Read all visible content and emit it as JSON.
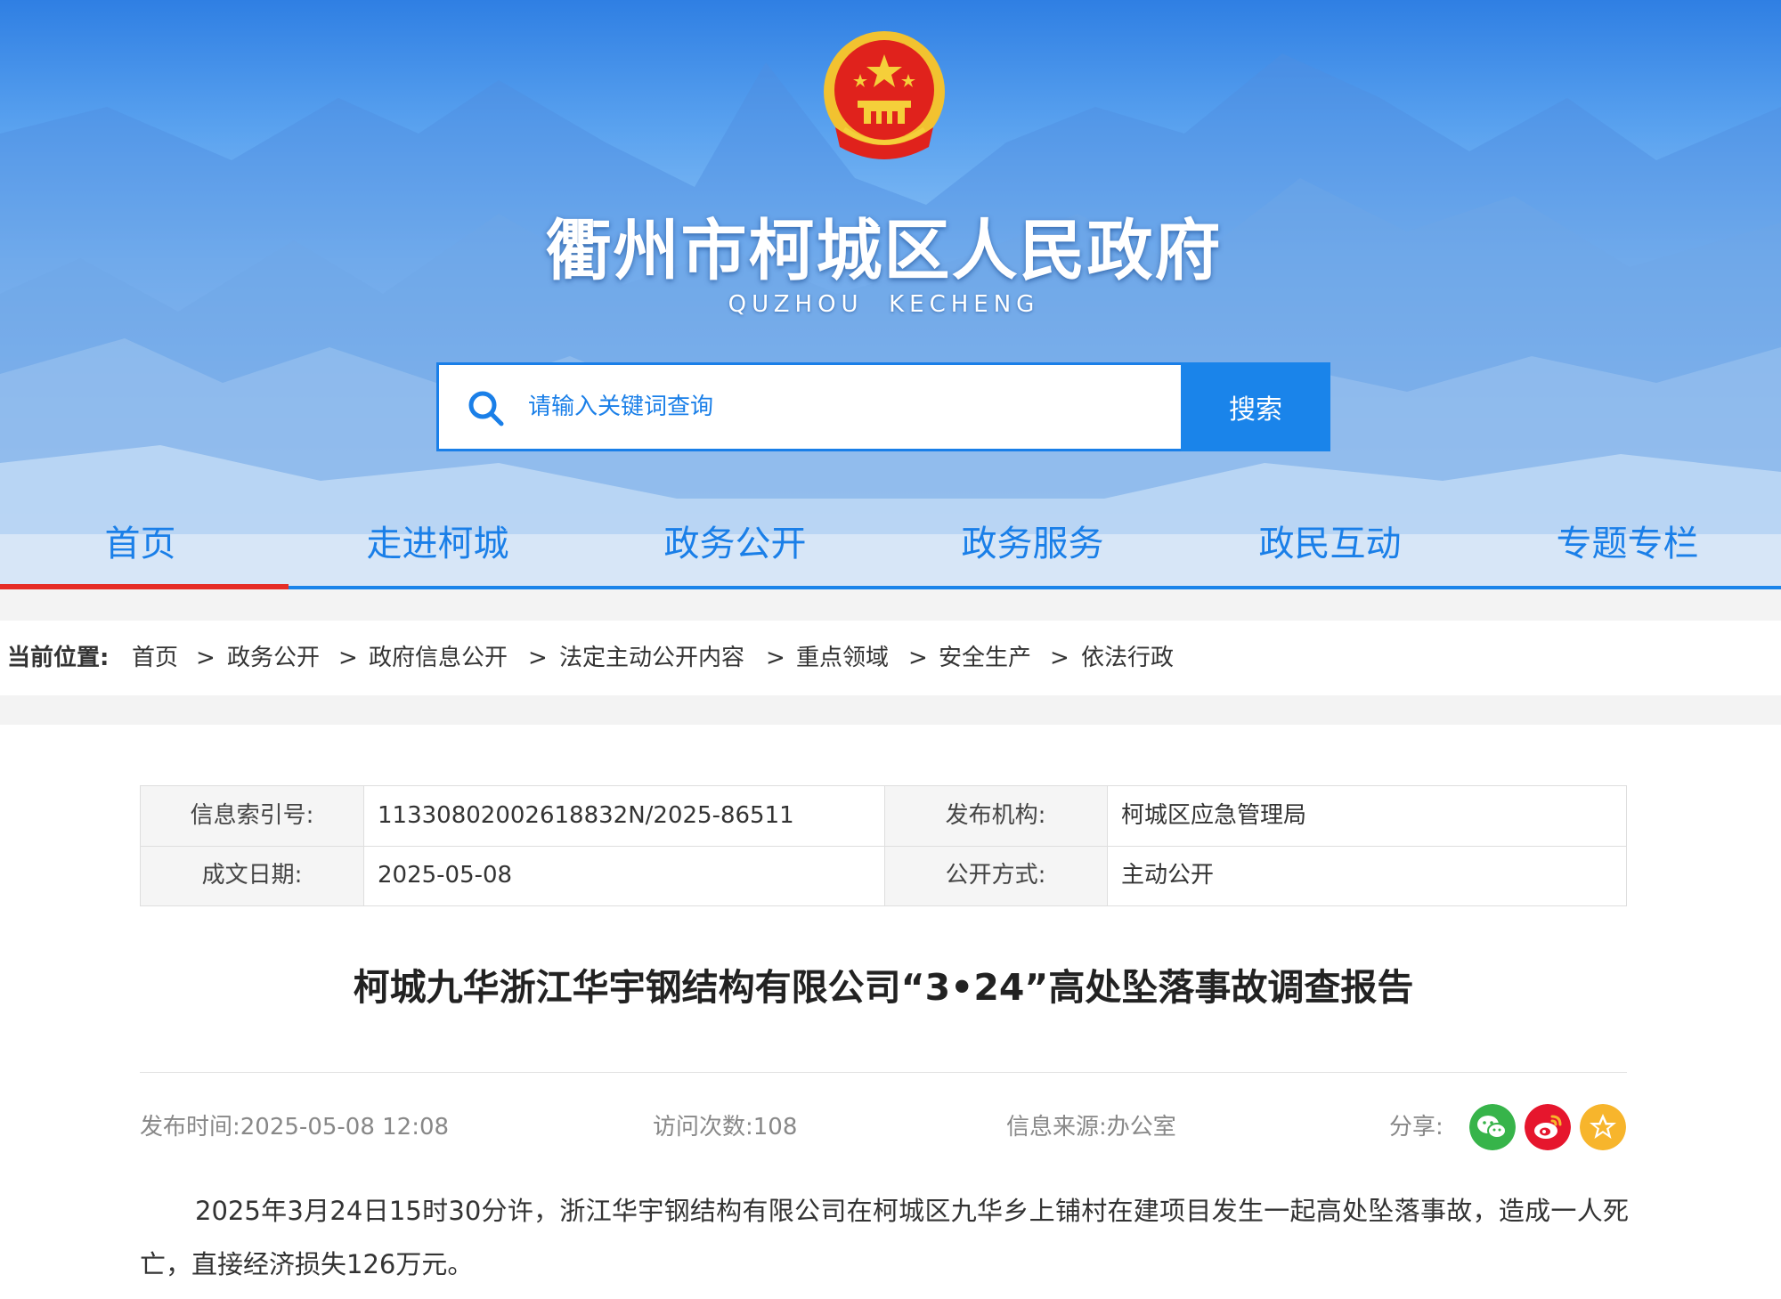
{
  "header": {
    "site_title": "衢州市柯城区人民政府",
    "site_subtitle": "QUZHOU  KECHENG",
    "search": {
      "placeholder": "请输入关键词查询",
      "button_label": "搜索"
    }
  },
  "nav": {
    "items": [
      {
        "label": "首页",
        "active": true
      },
      {
        "label": "走进柯城"
      },
      {
        "label": "政务公开"
      },
      {
        "label": "政务服务"
      },
      {
        "label": "政民互动"
      },
      {
        "label": "专题专栏"
      }
    ]
  },
  "breadcrumb": {
    "label": "当前位置:",
    "separator": ">",
    "items": [
      "首页",
      "政务公开",
      "政府信息公开",
      "法定主动公开内容",
      "重点领域",
      "安全生产",
      "依法行政"
    ]
  },
  "info_table": {
    "index_label": "信息索引号:",
    "index_value": "11330802002618832N/2025-86511",
    "publisher_label": "发布机构:",
    "publisher_value": "柯城区应急管理局",
    "date_label": "成文日期:",
    "date_value": "2025-05-08",
    "mode_label": "公开方式:",
    "mode_value": "主动公开"
  },
  "article": {
    "title": "柯城九华浙江华宇钢结构有限公司“3•24”高处坠落事故调查报告",
    "publish_time_label": "发布时间:",
    "publish_time": "2025-05-08 12:08",
    "visits_label": "访问次数:",
    "visits": "108",
    "source_label": "信息来源:",
    "source": "办公室",
    "share_label": "分享:",
    "body": "2025年3月24日15时30分许，浙江华宇钢结构有限公司在柯城区九华乡上铺村在建项目发生一起高处坠落事故，造成一人死亡，直接经济损失126万元。"
  },
  "colors": {
    "brand_blue": "#1a84ea",
    "active_red": "#e52d27",
    "wechat_green": "#37b44a",
    "weibo_red": "#e6162d",
    "qzone_yellow": "#f7b52c"
  },
  "icons": [
    "search-icon",
    "national-emblem-icon",
    "wechat-icon",
    "weibo-icon",
    "qzone-star-icon"
  ]
}
